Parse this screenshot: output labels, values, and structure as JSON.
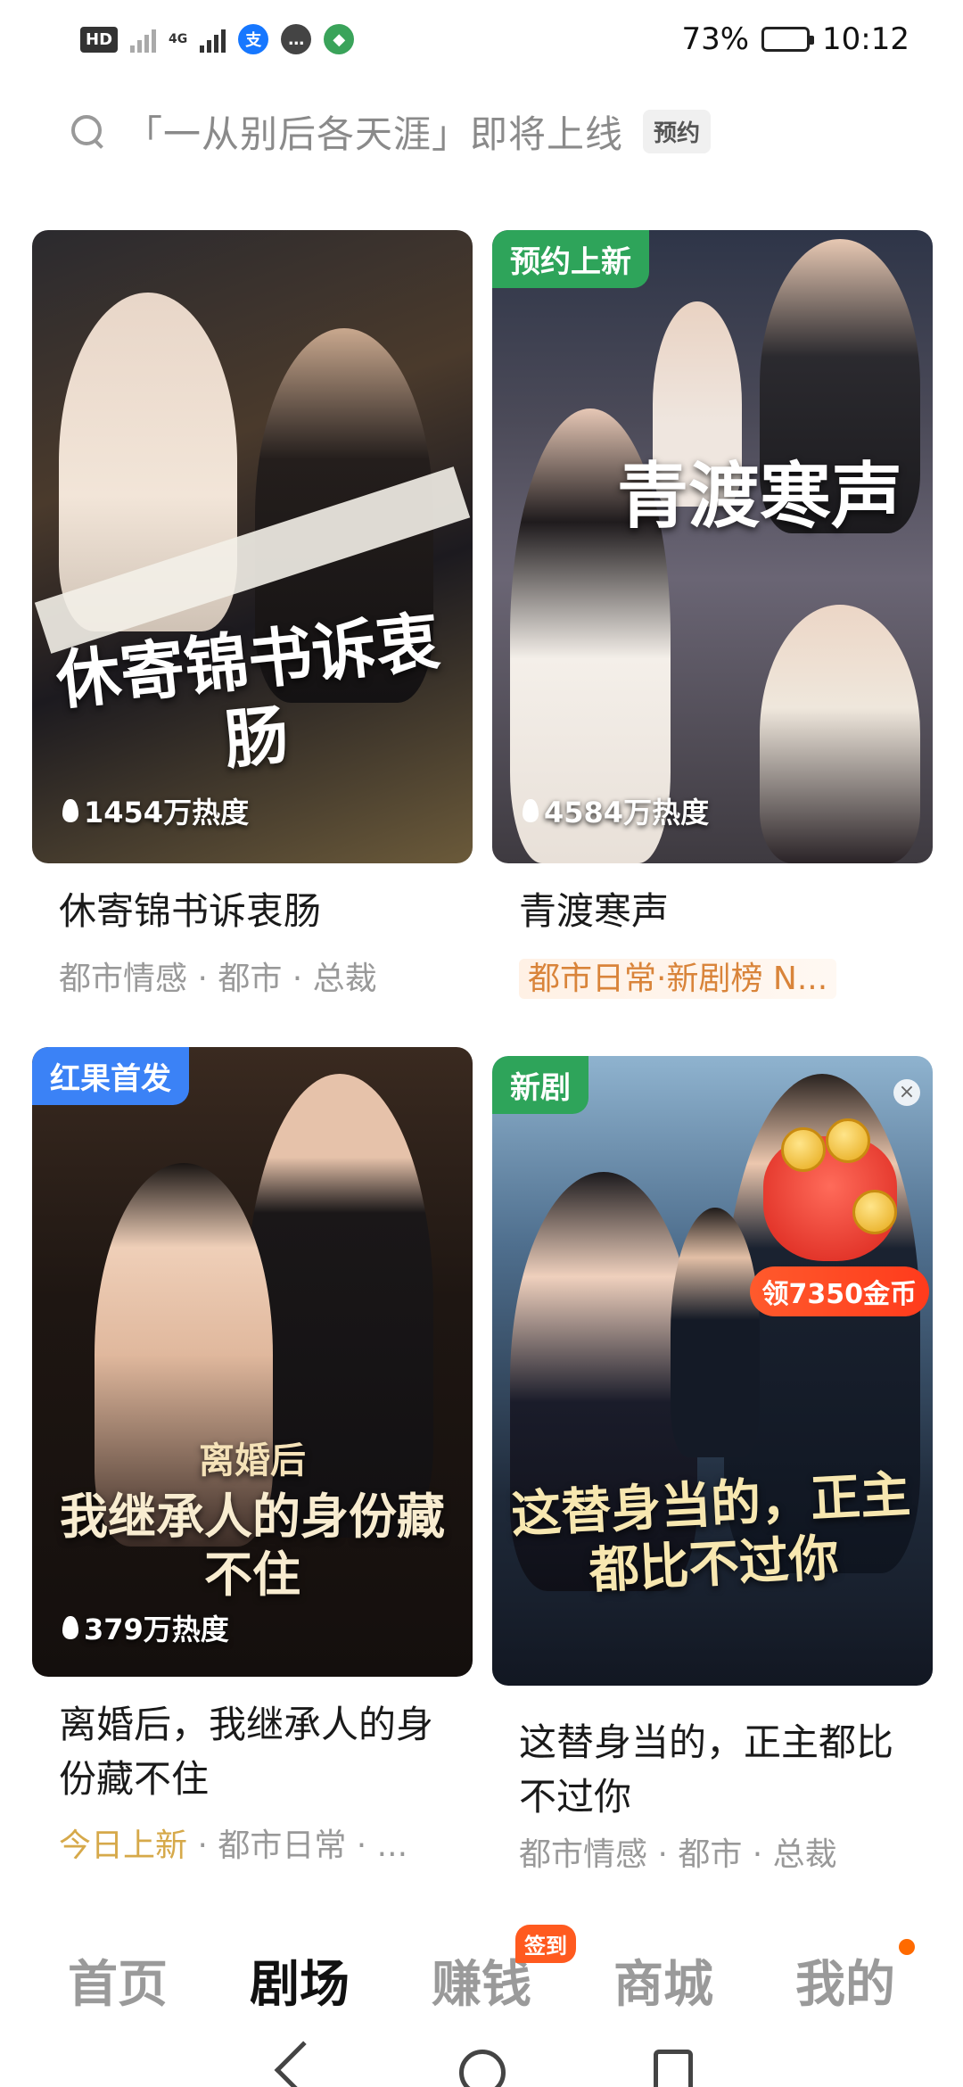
{
  "status_bar": {
    "hd": "HD",
    "net_4g": "4G",
    "alipay_glyph": "支",
    "battery_percent": "73%",
    "time": "10:12",
    "icons": [
      "hd-icon",
      "signal-icon",
      "alipay-icon",
      "chat-icon",
      "leaf-icon",
      "battery-icon"
    ]
  },
  "search": {
    "placeholder": "「一从别后各天涯」即将上线",
    "reserve_label": "预约"
  },
  "cards": [
    {
      "cover_title": "休寄锦书诉衷肠",
      "badge": "",
      "heat": "1454万热度",
      "title": "休寄锦书诉衷肠",
      "tags": "都市情感 · 都市 · 总裁"
    },
    {
      "cover_title": "青渡寒声",
      "badge": "预约上新",
      "heat": "4584万热度",
      "title": "青渡寒声",
      "tags": "都市日常·新剧榜 N..."
    },
    {
      "cover_title": "我继承人的身份藏不住",
      "cover_subtitle": "离婚后",
      "badge": "红果首发",
      "heat": "379万热度",
      "title": "离婚后，我继承人的身份藏不住",
      "tag_highlight": "今日上新",
      "tags": " · 都市日常 · ..."
    },
    {
      "cover_title": "这替身当的，正主都比不过你",
      "badge": "新剧",
      "title": "这替身当的，正主都比不过你",
      "tags": "都市情感 · 都市 · 总裁",
      "coin_label": "领7350金币"
    }
  ],
  "tab_bar": {
    "tabs": [
      "首页",
      "剧场",
      "赚钱",
      "商城",
      "我的"
    ],
    "active": "剧场",
    "sign_badge": "签到"
  },
  "colors": {
    "badge_green": "#2ea45a",
    "badge_blue": "#3b82f6",
    "tag_orange": "#d9843a",
    "tag_gold": "#d6a94a",
    "accent_red": "#ff5a1f"
  }
}
